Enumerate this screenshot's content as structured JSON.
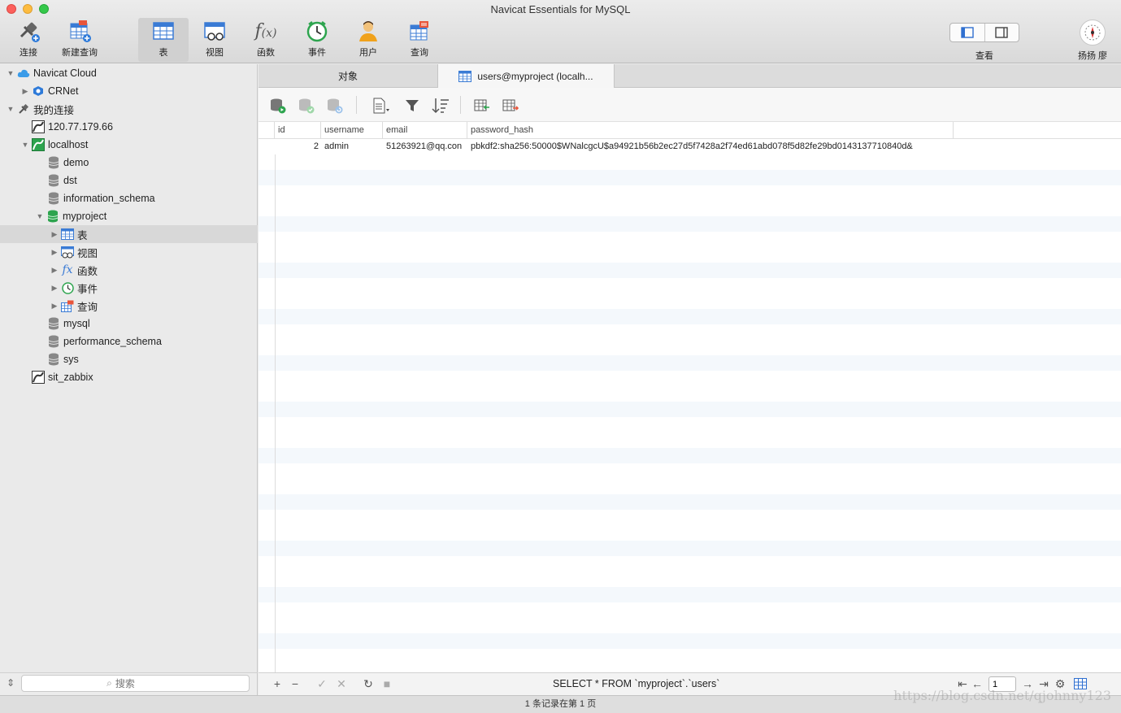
{
  "window": {
    "title": "Navicat Essentials for MySQL"
  },
  "toolbar": {
    "connect": "连接",
    "new_query": "新建查询",
    "table": "表",
    "view": "视图",
    "function": "函数",
    "event": "事件",
    "user": "用户",
    "query": "查询",
    "view_toggle_label": "查看",
    "account_name": "扬扬 廖"
  },
  "sidebar": {
    "items": [
      {
        "label": "Navicat Cloud"
      },
      {
        "label": "CRNet"
      },
      {
        "label": "我的连接"
      },
      {
        "label": "120.77.179.66"
      },
      {
        "label": "localhost"
      },
      {
        "label": "demo"
      },
      {
        "label": "dst"
      },
      {
        "label": "information_schema"
      },
      {
        "label": "myproject"
      },
      {
        "label": "表"
      },
      {
        "label": "视图"
      },
      {
        "label": "函数"
      },
      {
        "label": "事件"
      },
      {
        "label": "查询"
      },
      {
        "label": "mysql"
      },
      {
        "label": "performance_schema"
      },
      {
        "label": "sys"
      },
      {
        "label": "sit_zabbix"
      }
    ],
    "search_placeholder": "搜索"
  },
  "tabs": {
    "objects": "对象",
    "users": "users@myproject (localh..."
  },
  "grid": {
    "columns": [
      "id",
      "username",
      "email",
      "password_hash"
    ],
    "rows": [
      {
        "id": "2",
        "username": "admin",
        "email": "51263921@qq.con",
        "password_hash": "pbkdf2:sha256:50000$WNalcgcU$a94921b56b2ec27d5f7428a2f74ed61abd078f5d82fe29bd0143137710840d&"
      }
    ]
  },
  "bottombar": {
    "sql": "SELECT * FROM `myproject`.`users`",
    "page": "1"
  },
  "status": {
    "text": "1 条记录在第 1 页"
  },
  "watermark": "https://blog.csdn.net/qjohnny123"
}
